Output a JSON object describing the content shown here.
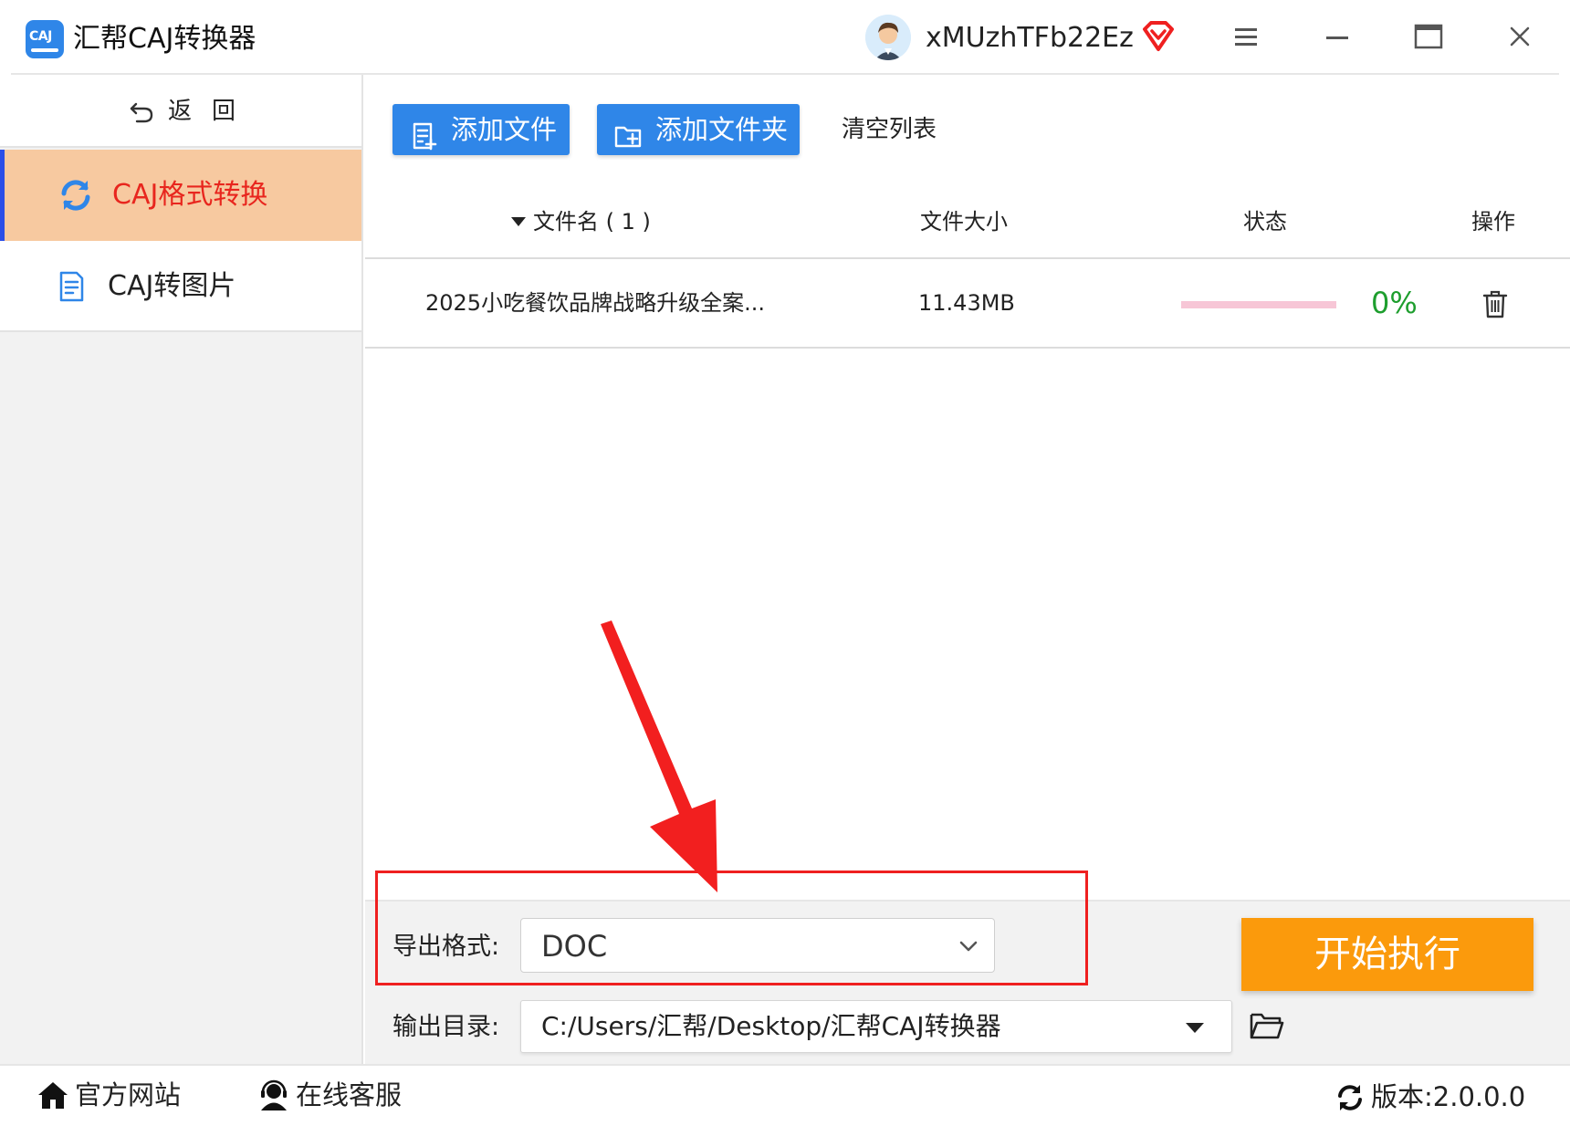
{
  "app": {
    "title": "汇帮CAJ转换器",
    "logo_text": "CAJ"
  },
  "user": {
    "name": "xMUzhTFb22Ez"
  },
  "sidebar": {
    "back_label": "返回",
    "items": [
      {
        "label": "CAJ格式转换",
        "active": true
      },
      {
        "label": "CAJ转图片",
        "active": false
      }
    ]
  },
  "toolbar": {
    "add_file": "添加文件",
    "add_folder": "添加文件夹",
    "clear_list": "清空列表"
  },
  "table": {
    "columns": {
      "name": "文件名 ( 1 )",
      "size": "文件大小",
      "status": "状态",
      "ops": "操作"
    },
    "rows": [
      {
        "name": "2025小吃餐饮品牌战略升级全案...",
        "size": "11.43MB",
        "progress": 0,
        "progress_text": "0%"
      }
    ]
  },
  "settings": {
    "format_label": "导出格式:",
    "format_value": "DOC",
    "output_label": "输出目录:",
    "output_value": "C:/Users/汇帮/Desktop/汇帮CAJ转换器",
    "start_label": "开始执行"
  },
  "footer": {
    "site": "官方网站",
    "support": "在线客服",
    "version": "版本:2.0.0.0"
  },
  "colors": {
    "accent_blue": "#2f86e8",
    "active_nav_bg": "#f7c9a0",
    "active_nav_text": "#e8261e",
    "start_button": "#fb9a0c",
    "progress_track": "#f7c6d6",
    "progress_text": "#1e9e2e",
    "annotation_red": "#ef2020"
  }
}
